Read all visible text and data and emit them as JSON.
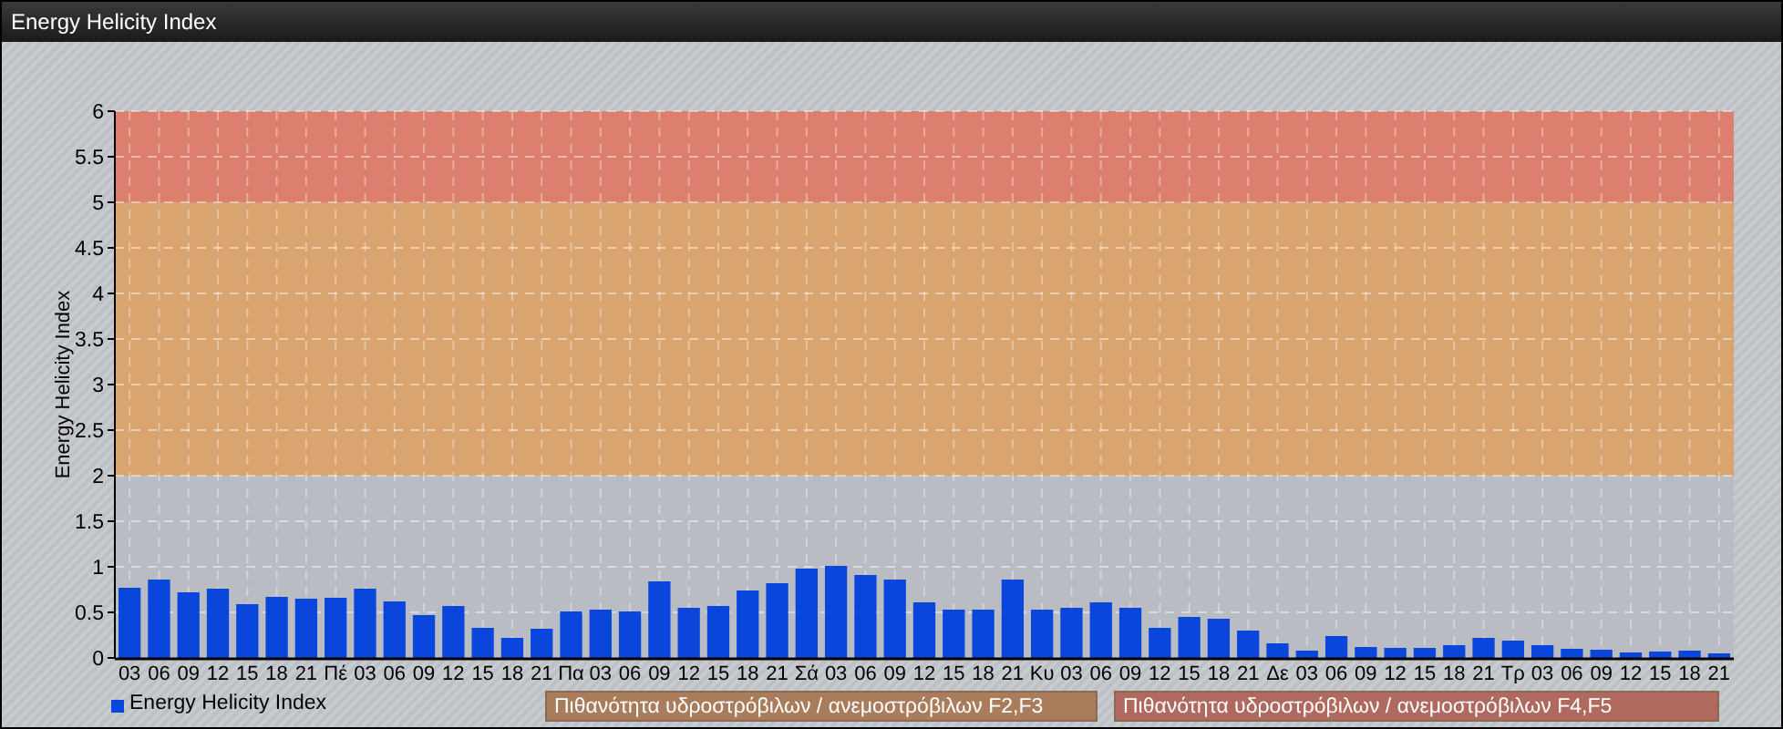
{
  "window": {
    "title": "Energy Helicity Index"
  },
  "chart": {
    "chart_data": {
      "type": "bar",
      "ylabel": "Energy Helicity Index",
      "categories": [
        "03",
        "06",
        "09",
        "12",
        "15",
        "18",
        "21",
        "Πέ",
        "03",
        "06",
        "09",
        "12",
        "15",
        "18",
        "21",
        "Πα",
        "03",
        "06",
        "09",
        "12",
        "15",
        "18",
        "21",
        "Σά",
        "03",
        "06",
        "09",
        "12",
        "15",
        "18",
        "21",
        "Κυ",
        "03",
        "06",
        "09",
        "12",
        "15",
        "18",
        "21",
        "Δε",
        "03",
        "06",
        "09",
        "12",
        "15",
        "18",
        "21",
        "Τρ",
        "03",
        "06",
        "09",
        "12",
        "15",
        "18",
        "21"
      ],
      "series": [
        {
          "name": "Energy Helicity Index",
          "color": "#0a46dc",
          "values": [
            0.77,
            0.86,
            0.72,
            0.76,
            0.59,
            0.67,
            0.65,
            0.66,
            0.76,
            0.62,
            0.47,
            0.57,
            0.33,
            0.22,
            0.32,
            0.51,
            0.53,
            0.51,
            0.84,
            0.55,
            0.57,
            0.74,
            0.82,
            0.98,
            1.01,
            0.91,
            0.86,
            0.61,
            0.53,
            0.53,
            0.86,
            0.53,
            0.55,
            0.61,
            0.55,
            0.33,
            0.45,
            0.43,
            0.3,
            0.16,
            0.08,
            0.24,
            0.12,
            0.11,
            0.11,
            0.14,
            0.22,
            0.19,
            0.14,
            0.1,
            0.09,
            0.06,
            0.07,
            0.08,
            0.05
          ]
        }
      ],
      "ylim": [
        0,
        6
      ],
      "yticks": [
        0,
        {
          "value": 0.5,
          "label": "0.5"
        },
        1,
        {
          "value": 1.5,
          "label": "1.5"
        },
        2,
        {
          "value": 2.5,
          "label": "2.5"
        },
        3,
        {
          "value": 3.5,
          "label": "3.5"
        },
        4,
        {
          "value": 4.5,
          "label": "4.5"
        },
        5,
        {
          "value": 5.5,
          "label": "5.5"
        },
        6
      ],
      "grid": true,
      "bands": [
        {
          "axis": "y",
          "from": 0,
          "to": 2,
          "color": "#b9bcc3"
        },
        {
          "axis": "y",
          "from": 2,
          "to": 5,
          "color": "#d9a470"
        },
        {
          "axis": "y",
          "from": 5,
          "to": 6,
          "color": "#dd7f6e"
        }
      ]
    }
  },
  "legend": [
    {
      "label": "Πιθανότητα υδροστρόβιλων / ανεμοστρόβιλων F2,F3",
      "color": "#a97c5c"
    },
    {
      "label": "Πιθανότητα υδροστρόβιλων / ανεμοστρόβιλων F4,F5",
      "color": "#b0695e"
    }
  ]
}
